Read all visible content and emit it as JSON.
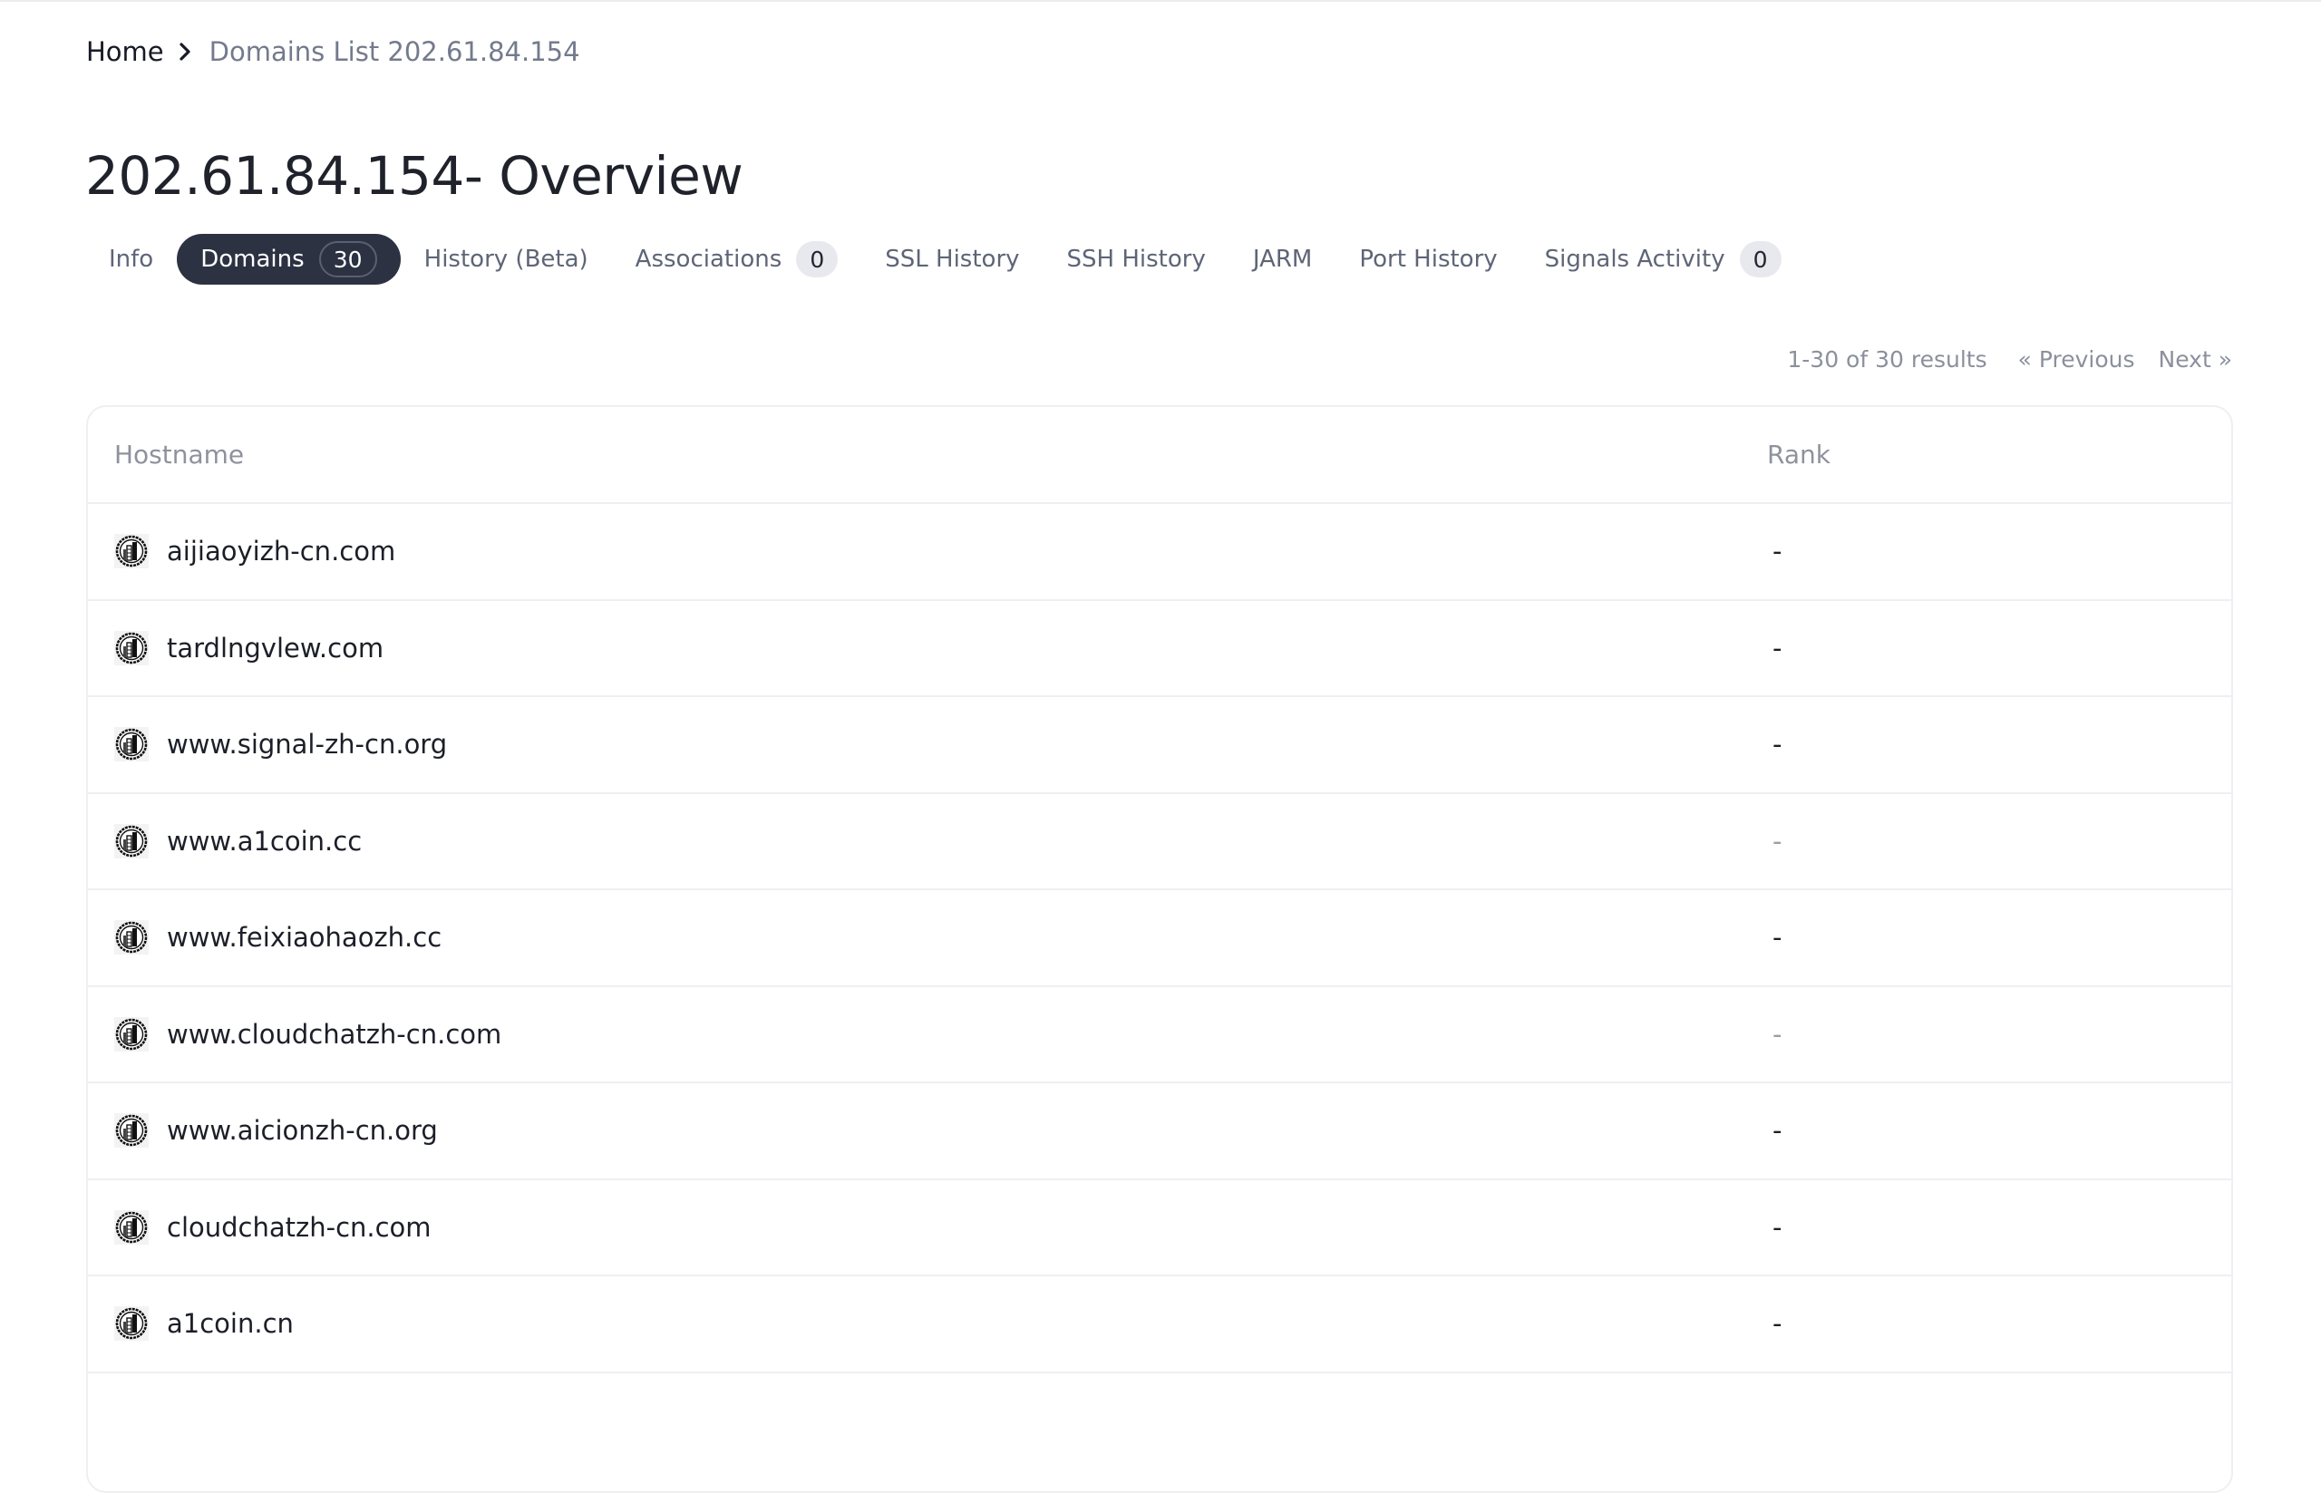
{
  "breadcrumb": {
    "home": "Home",
    "current": "Domains List 202.61.84.154"
  },
  "page": {
    "title": "202.61.84.154- Overview"
  },
  "tabs": [
    {
      "label": "Info",
      "active": false
    },
    {
      "label": "Domains",
      "badge": "30",
      "active": true
    },
    {
      "label": "History (Beta)",
      "active": false
    },
    {
      "label": "Associations",
      "badge": "0",
      "active": false
    },
    {
      "label": "SSL History",
      "active": false
    },
    {
      "label": "SSH History",
      "active": false
    },
    {
      "label": "JARM",
      "active": false
    },
    {
      "label": "Port History",
      "active": false
    },
    {
      "label": "Signals Activity",
      "badge": "0",
      "active": false
    }
  ],
  "pagination": {
    "results": "1-30 of 30 results",
    "previous": "« Previous",
    "next": "Next »"
  },
  "table": {
    "columns": [
      "Hostname",
      "Rank"
    ],
    "row_icon": "site-favicon-icon",
    "rows": [
      {
        "hostname": "aijiaoyizh-cn.com",
        "rank": "-"
      },
      {
        "hostname": "tardlngvlew.com",
        "rank": "-"
      },
      {
        "hostname": "www.signal-zh-cn.org",
        "rank": "-"
      },
      {
        "hostname": "www.a1coin.cc",
        "rank": "-"
      },
      {
        "hostname": "www.feixiaohaozh.cc",
        "rank": "-"
      },
      {
        "hostname": "www.cloudchatzh-cn.com",
        "rank": "-"
      },
      {
        "hostname": "www.aicionzh-cn.org",
        "rank": "-"
      },
      {
        "hostname": "cloudchatzh-cn.com",
        "rank": "-"
      },
      {
        "hostname": "a1coin.cn",
        "rank": "-"
      }
    ]
  },
  "colors": {
    "active_tab_bg": "#2d3242",
    "muted_text": "#737a8c",
    "badge_bg": "#e8e9ee",
    "border": "#eeeff2"
  }
}
